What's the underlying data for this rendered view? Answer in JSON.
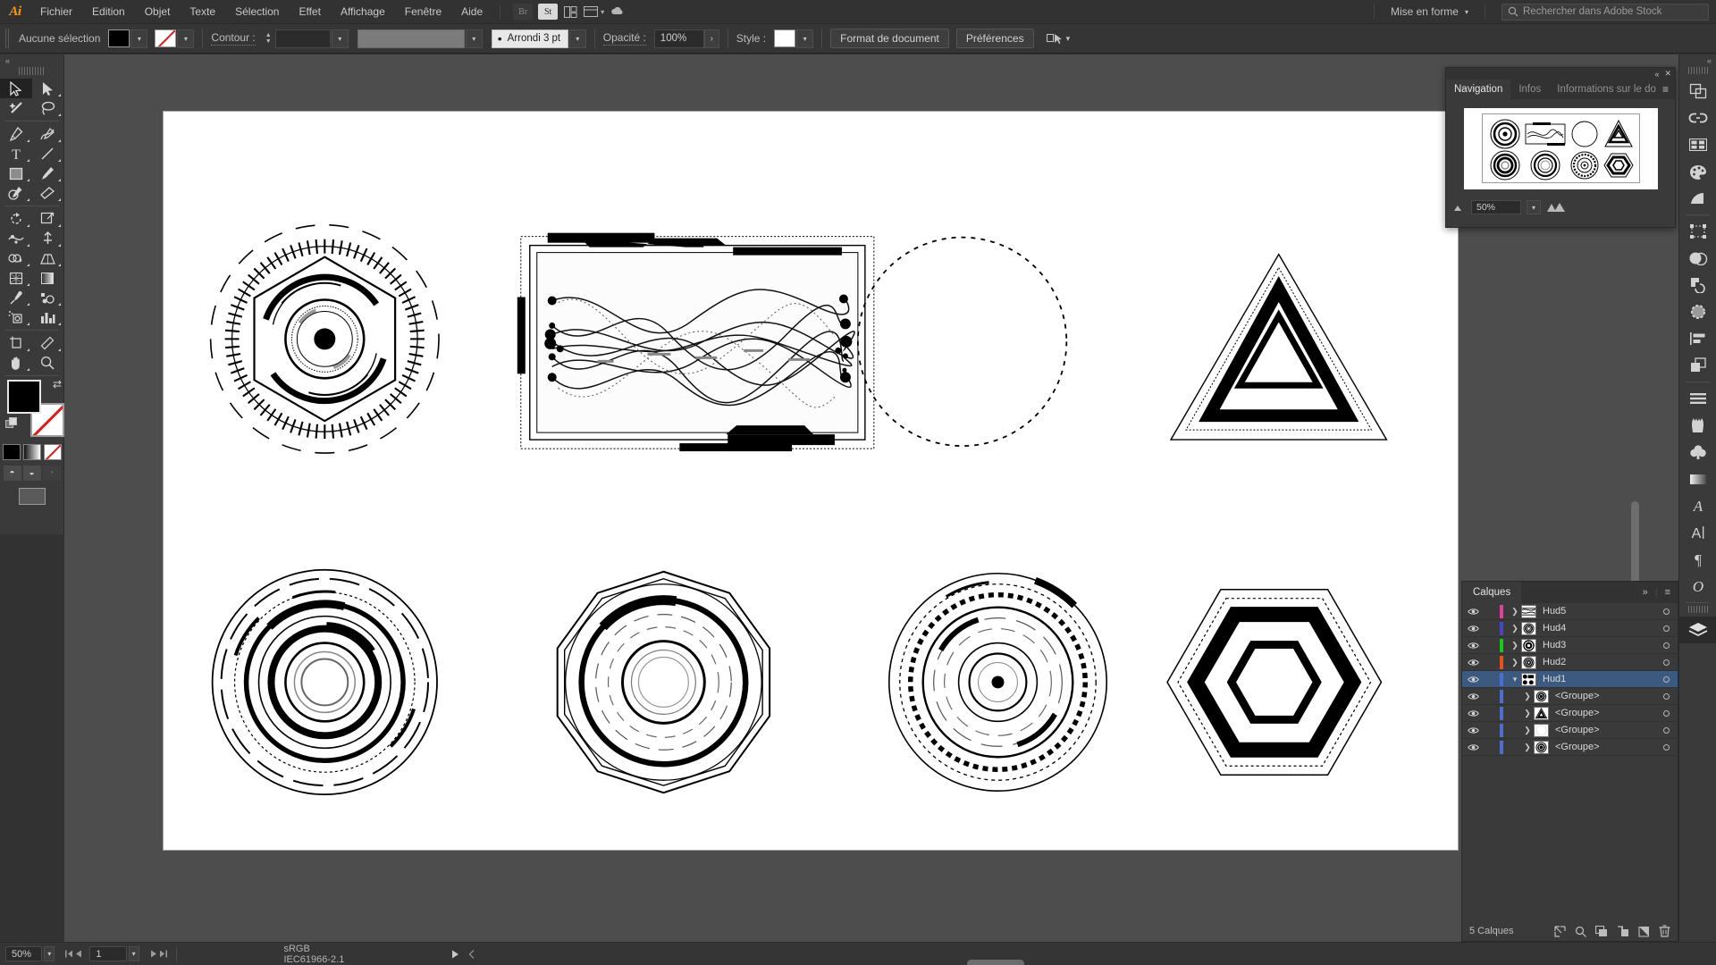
{
  "app": {
    "logo": "Ai",
    "title": "Adobe Illustrator"
  },
  "menubar": {
    "items": [
      "Fichier",
      "Edition",
      "Objet",
      "Texte",
      "Sélection",
      "Effet",
      "Affichage",
      "Fenêtre",
      "Aide"
    ],
    "badges": [
      "Br",
      "St"
    ],
    "workspace": "Mise en forme",
    "workspace_caret": "chevron-down-icon",
    "search_placeholder": "Rechercher dans Adobe Stock"
  },
  "controlbar": {
    "selection_status": "Aucune sélection",
    "fill_color": "#000000",
    "stroke_color": "none",
    "stroke_label": "Contour :",
    "stroke_weight": "",
    "profile_value": "",
    "brush_value": "Arrondi 3 pt",
    "opacity_label": "Opacité :",
    "opacity_value": "100%",
    "style_label": "Style :",
    "style_color": "#ffffff",
    "doc_setup_button": "Format de document",
    "preferences_button": "Préférences"
  },
  "toolbar": {
    "collapse": "«",
    "tools": [
      {
        "name": "selection-tool",
        "selected": true
      },
      {
        "name": "direct-selection-tool",
        "selected": false
      },
      {
        "name": "magic-wand-tool",
        "selected": false
      },
      {
        "name": "lasso-tool",
        "selected": false
      },
      {
        "name": "pen-tool",
        "selected": false
      },
      {
        "name": "curvature-tool",
        "selected": false
      },
      {
        "name": "type-tool",
        "selected": false
      },
      {
        "name": "line-segment-tool",
        "selected": false
      },
      {
        "name": "rectangle-tool",
        "selected": false
      },
      {
        "name": "paintbrush-tool",
        "selected": false
      },
      {
        "name": "shaper-tool",
        "selected": false
      },
      {
        "name": "eraser-tool",
        "selected": false
      },
      {
        "name": "rotate-tool",
        "selected": false
      },
      {
        "name": "scale-tool",
        "selected": false
      },
      {
        "name": "width-tool",
        "selected": false
      },
      {
        "name": "free-transform-tool",
        "selected": false
      },
      {
        "name": "shape-builder-tool",
        "selected": false
      },
      {
        "name": "perspective-grid-tool",
        "selected": false
      },
      {
        "name": "mesh-tool",
        "selected": false
      },
      {
        "name": "gradient-tool",
        "selected": false
      },
      {
        "name": "eyedropper-tool",
        "selected": false
      },
      {
        "name": "blend-tool",
        "selected": false
      },
      {
        "name": "symbol-sprayer-tool",
        "selected": false
      },
      {
        "name": "column-graph-tool",
        "selected": false
      },
      {
        "name": "artboard-tool",
        "selected": false
      },
      {
        "name": "slice-tool",
        "selected": false
      },
      {
        "name": "hand-tool",
        "selected": false
      },
      {
        "name": "zoom-tool",
        "selected": false
      }
    ],
    "fill_color": "#000000",
    "stroke_color": "#ffffff",
    "modes": [
      "color-fill",
      "gradient-fill",
      "none-fill"
    ],
    "draw_modes": [
      "draw-normal",
      "draw-behind",
      "draw-inside"
    ]
  },
  "navigation_panel": {
    "tabs": [
      {
        "label": "Navigation",
        "active": true
      },
      {
        "label": "Infos",
        "active": false
      },
      {
        "label": "Informations sur le do",
        "active": false
      }
    ],
    "zoom_value": "50%",
    "menu_icon": "panel-menu-icon"
  },
  "right_dock": {
    "icons": [
      "pathfinder-icon",
      "links-icon",
      "artboards-icon",
      "color-icon",
      "color-guide-icon",
      "transform-icon",
      "transparency-icon",
      "image-trace-icon",
      "stroke-icon",
      "align-icon",
      "appearance-icon",
      "swatches-icon",
      "brushes-icon",
      "symbols-icon",
      "gradient-icon",
      "graphic-styles-icon",
      "character-icon",
      "paragraph-icon",
      "opacity-icon",
      "layers-icon"
    ]
  },
  "layers_panel": {
    "tab_label": "Calques",
    "collapse_icon": "double-chevron-icon",
    "menu_icon": "panel-menu-icon",
    "rows": [
      {
        "name": "Hud5",
        "color": "#e040a0",
        "selected": false,
        "child": false,
        "expanded": false,
        "thumb": "hud-waves-thumb"
      },
      {
        "name": "Hud4",
        "color": "#4646c8",
        "selected": false,
        "child": false,
        "expanded": false,
        "thumb": "hud-circle-thumb"
      },
      {
        "name": "Hud3",
        "color": "#19c819",
        "selected": false,
        "child": false,
        "expanded": false,
        "thumb": "hud-circle2-thumb"
      },
      {
        "name": "Hud2",
        "color": "#e8501e",
        "selected": false,
        "child": false,
        "expanded": false,
        "thumb": "hud-circle3-thumb"
      },
      {
        "name": "Hud1",
        "color": "#4a6fd0",
        "selected": true,
        "child": false,
        "expanded": true,
        "thumb": "hud-group-thumb"
      },
      {
        "name": "<Groupe>",
        "color": "#4a6fd0",
        "selected": false,
        "child": true,
        "expanded": false,
        "thumb": "group-circle-thumb"
      },
      {
        "name": "<Groupe>",
        "color": "#4a6fd0",
        "selected": false,
        "child": true,
        "expanded": false,
        "thumb": "group-triangle-thumb"
      },
      {
        "name": "<Groupe>",
        "color": "#4a6fd0",
        "selected": false,
        "child": true,
        "expanded": false,
        "thumb": "group-blank-thumb"
      },
      {
        "name": "<Groupe>",
        "color": "#4a6fd0",
        "selected": false,
        "child": true,
        "expanded": false,
        "thumb": "group-circle2-thumb"
      }
    ],
    "footer_count": "5 Calques",
    "footer_icons": [
      "locate-object-icon",
      "search-icon",
      "new-sublayer-icon",
      "new-layer-icon",
      "duplicate-icon",
      "delete-icon"
    ]
  },
  "statusbar": {
    "zoom_value": "50%",
    "page_value": "1",
    "color_profile": "sRGB IEC61966-2.1",
    "nav_first": "first-page-icon",
    "nav_prev": "prev-page-icon",
    "nav_next": "next-page-icon",
    "nav_last": "last-page-icon"
  },
  "artwork": {
    "description": "HUD sci-fi vector shapes on white artboard",
    "items": [
      "hud-gear-circle",
      "hud-wave-panel",
      "dotted-circle",
      "triangle-stack",
      "hud-rings-circle",
      "hud-polygon-circle",
      "hud-dashed-circle",
      "hexagon-stack"
    ]
  }
}
